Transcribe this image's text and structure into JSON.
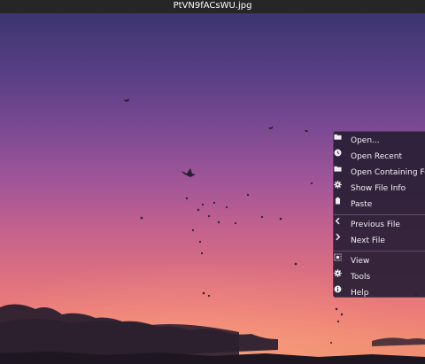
{
  "window": {
    "title": "PtVN9fACsWU.jpg"
  },
  "context_menu": {
    "groups": [
      [
        {
          "label": "Open...",
          "icon": "folder-icon"
        },
        {
          "label": "Open Recent",
          "icon": "clock-icon"
        },
        {
          "label": "Open Containing Folder",
          "icon": "folder-icon"
        },
        {
          "label": "Show File Info",
          "icon": "gear-icon"
        },
        {
          "label": "Paste",
          "icon": "clipboard-icon"
        }
      ],
      [
        {
          "label": "Previous File",
          "icon": "chevron-left-icon"
        },
        {
          "label": "Next File",
          "icon": "chevron-right-icon"
        }
      ],
      [
        {
          "label": "View",
          "icon": "view-icon"
        },
        {
          "label": "Tools",
          "icon": "gear-icon"
        },
        {
          "label": "Help",
          "icon": "info-icon"
        }
      ]
    ]
  },
  "colors": {
    "titlebar_bg": "#262626",
    "menu_bg": "#281e34",
    "menu_text": "#f1eef5"
  }
}
